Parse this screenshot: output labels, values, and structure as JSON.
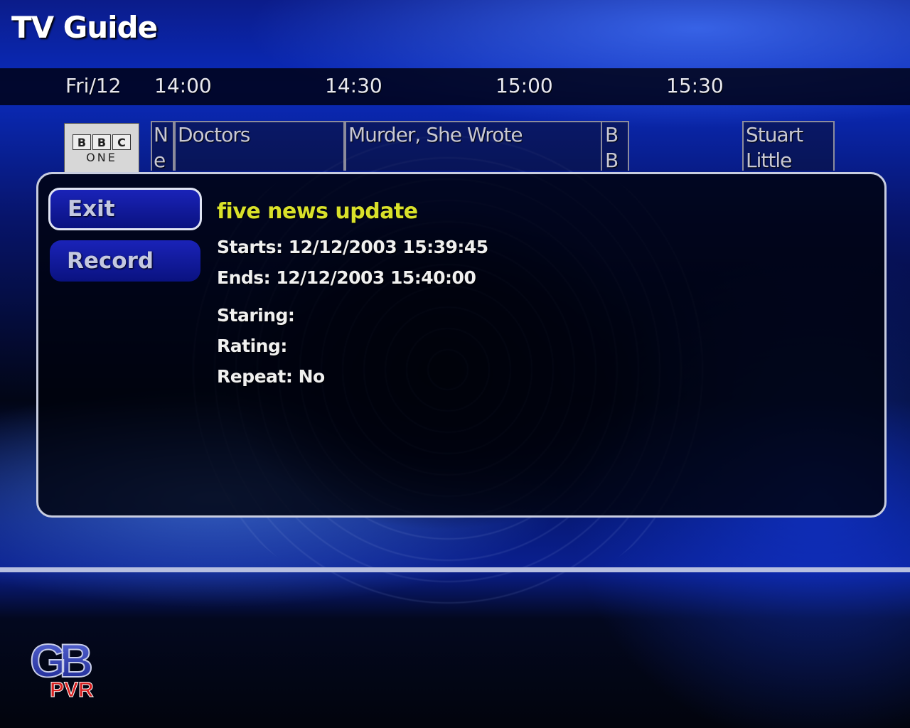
{
  "app": {
    "title": "TV Guide"
  },
  "timebar": {
    "date": "Fri/12",
    "times": [
      "14:00",
      "14:30",
      "15:00",
      "15:30"
    ]
  },
  "channel": {
    "logo_letters": [
      "B",
      "B",
      "C"
    ],
    "logo_sub": "ONE"
  },
  "programmes": [
    {
      "label": "N e"
    },
    {
      "label": "Doctors"
    },
    {
      "label": "Murder, She Wrote"
    },
    {
      "label": "B B"
    },
    {
      "label": "Stuart Little"
    }
  ],
  "menu": {
    "exit_label": "Exit",
    "record_label": "Record"
  },
  "details": {
    "title": "five news update",
    "starts": "Starts: 12/12/2003 15:39:45",
    "ends": "Ends: 12/12/2003 15:40:00",
    "staring": "Staring:",
    "rating": "Rating:",
    "repeat": "Repeat: No"
  },
  "brand": {
    "logo_top": "GB",
    "logo_bottom": "PVR"
  },
  "colors": {
    "title_accent": "#d9e12a",
    "button_blue": "#1a23b8",
    "panel_border": "#c8cde0"
  }
}
